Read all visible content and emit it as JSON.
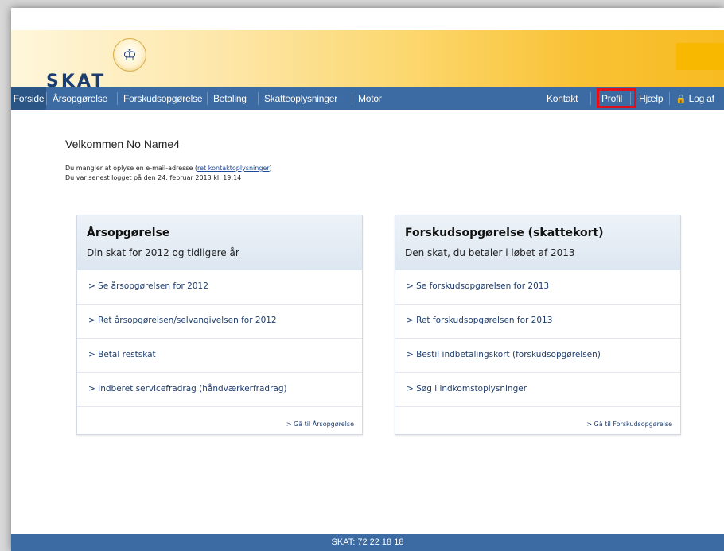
{
  "brand": {
    "name": "SKAT",
    "crown_glyph": "♔"
  },
  "nav": {
    "left": [
      "Forside",
      "Årsopgørelse",
      "Forskudsopgørelse",
      "Betaling",
      "Skatteoplysninger",
      "Motor"
    ],
    "right": {
      "kontakt": "Kontakt",
      "profil": "Profil",
      "hjaelp": "Hjælp",
      "logaf": "Log af"
    },
    "active": "Forside",
    "highlight_color": "#e0101a"
  },
  "welcome": {
    "title": "Velkommen No Name4",
    "line1_prefix": "Du mangler at oplyse en e-mail-adresse (",
    "line1_link": "ret kontaktoplysninger",
    "line1_suffix": ")",
    "line2": "Du var senest logget på den 24. februar 2013 kl. 19:14"
  },
  "panels": {
    "left": {
      "title": "Årsopgørelse",
      "subtitle": "Din skat for 2012 og tidligere år",
      "links": [
        "> Se årsopgørelsen for 2012",
        "> Ret årsopgørelsen/selvangivelsen for 2012",
        "> Betal restskat",
        "> Indberet servicefradrag (håndværkerfradrag)"
      ],
      "footer": "> Gå til Årsopgørelse"
    },
    "right": {
      "title": "Forskudsopgørelse (skattekort)",
      "subtitle": "Den skat, du betaler i løbet af 2013",
      "links": [
        "> Se forskudsopgørelsen for 2013",
        "> Ret forskudsopgørelsen for 2013",
        "> Bestil indbetalingskort (forskudsopgørelsen)",
        "> Søg i indkomstoplysninger"
      ],
      "footer": "> Gå til Forskudsopgørelse"
    }
  },
  "footer": {
    "text": "SKAT: 72 22 18 18"
  },
  "colors": {
    "nav": "#3b6ba2",
    "header_gold": "#f8bb22",
    "link": "#1d3c6e"
  }
}
